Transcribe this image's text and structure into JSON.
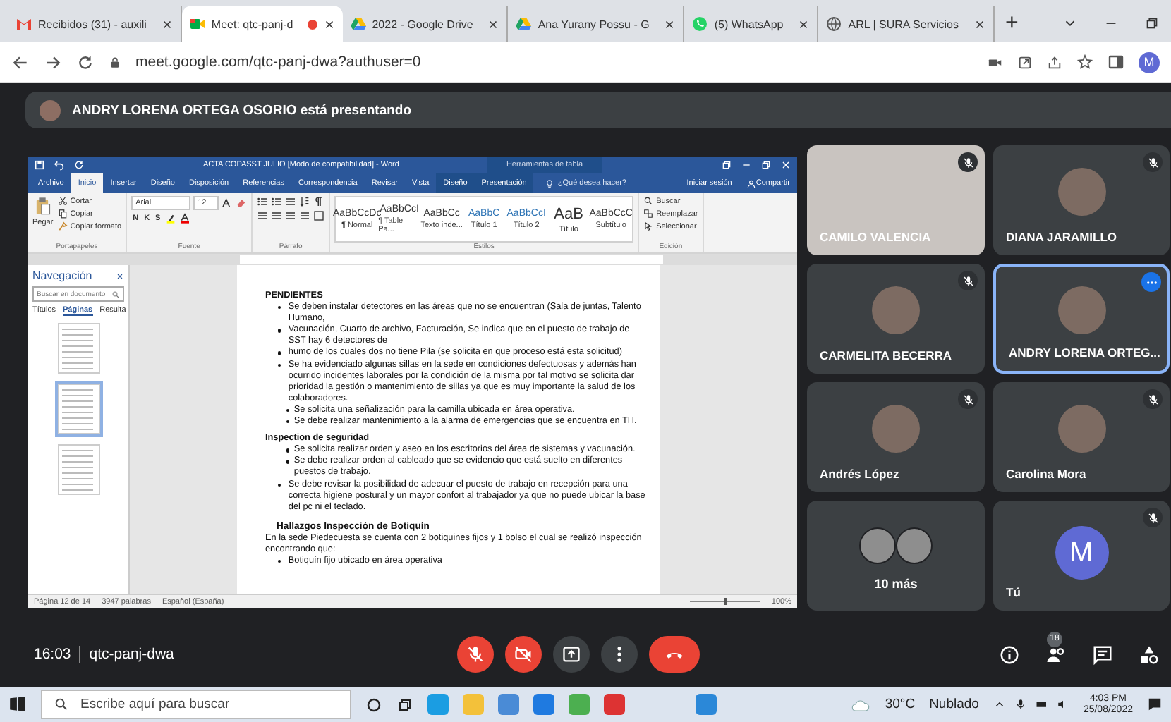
{
  "browser": {
    "tabs": [
      {
        "kind": "mail",
        "title": "Recibidos (31) - auxili",
        "selected": false,
        "recording": false
      },
      {
        "kind": "meet",
        "title": "Meet: qtc-panj-d",
        "selected": true,
        "recording": true
      },
      {
        "kind": "drive",
        "title": "2022 - Google Drive",
        "selected": false,
        "recording": false
      },
      {
        "kind": "drive",
        "title": "Ana Yurany Possu - G",
        "selected": false,
        "recording": false
      },
      {
        "kind": "whatsapp",
        "title": "(5) WhatsApp",
        "selected": false,
        "recording": false
      },
      {
        "kind": "globe",
        "title": "ARL | SURA Servicios",
        "selected": false,
        "recording": false
      }
    ],
    "new_tab": "+",
    "url": "meet.google.com/qtc-panj-dwa?authuser=0",
    "profile": "M"
  },
  "banner": {
    "text": "ANDRY LORENA ORTEGA OSORIO está presentando"
  },
  "word": {
    "title": "ACTA COPASST JULIO [Modo de compatibilidad] - Word",
    "context_label": "Herramientas de tabla",
    "tabs": [
      {
        "label": "Archivo",
        "selected": false,
        "contextual": false
      },
      {
        "label": "Inicio",
        "selected": true,
        "contextual": false
      },
      {
        "label": "Insertar",
        "selected": false,
        "contextual": false
      },
      {
        "label": "Diseño",
        "selected": false,
        "contextual": false
      },
      {
        "label": "Disposición",
        "selected": false,
        "contextual": false
      },
      {
        "label": "Referencias",
        "selected": false,
        "contextual": false
      },
      {
        "label": "Correspondencia",
        "selected": false,
        "contextual": false
      },
      {
        "label": "Revisar",
        "selected": false,
        "contextual": false
      },
      {
        "label": "Vista",
        "selected": false,
        "contextual": false
      },
      {
        "label": "Diseño",
        "selected": false,
        "contextual": true
      },
      {
        "label": "Presentación",
        "selected": false,
        "contextual": true
      }
    ],
    "tell_me": "¿Qué desea hacer?",
    "sign_in": "Iniciar sesión",
    "share": "Compartir",
    "paste": "Pegar",
    "clipboard": [
      "Cortar",
      "Copiar",
      "Copiar formato"
    ],
    "font": "Arial",
    "size": "12",
    "format_buttons": [
      "N",
      "K",
      "S"
    ],
    "styles": [
      {
        "preview": "AaBbCcDc",
        "name": "¶ Normal"
      },
      {
        "preview": "AaBbCcI",
        "name": "¶ Table Pa..."
      },
      {
        "preview": "AaBbCc",
        "name": "Texto inde..."
      },
      {
        "preview": "AaBbC",
        "name": "Título 1"
      },
      {
        "preview": "AaBbCcI",
        "name": "Título 2"
      },
      {
        "preview": "AaB",
        "name": "Título"
      },
      {
        "preview": "AaBbCcC",
        "name": "Subtítulo"
      }
    ],
    "editing": [
      "Buscar",
      "Reemplazar",
      "Seleccionar"
    ],
    "groups": [
      "Portapapeles",
      "Fuente",
      "Párrafo",
      "Estilos",
      "Edición"
    ],
    "nav": {
      "title": "Navegación",
      "placeholder": "Buscar en documento",
      "tabs": [
        {
          "label": "Títulos",
          "selected": false
        },
        {
          "label": "Páginas",
          "selected": true
        },
        {
          "label": "Resulta",
          "selected": false
        }
      ]
    },
    "document": [
      {
        "kind": "heading",
        "text": "PENDIENTES"
      },
      {
        "kind": "bullet",
        "text": "Se deben instalar detectores en las áreas que no se encuentran (Sala de juntas, Talento Humano,"
      },
      {
        "kind": "bullet",
        "text": "Vacunación, Cuarto de archivo, Facturación, Se indica que en el puesto de trabajo de SST hay 6 detectores de"
      },
      {
        "kind": "bullet",
        "text": "humo de los cuales dos no tiene Pila (se solicita en que proceso está esta solicitud)"
      },
      {
        "kind": "bullet",
        "text": "Se ha evidenciado algunas sillas en la sede en condiciones defectuosas y además han ocurrido incidentes laborales por la condición de la misma por tal motivo se solicita dar prioridad la gestión o mantenimiento de sillas ya que es muy importante la salud de los colaboradores."
      },
      {
        "kind": "subbullet",
        "text": "Se solicita una señalización para la camilla ubicada en área operativa."
      },
      {
        "kind": "subbullet",
        "text": "Se debe realizar mantenimiento a la alarma de emergencias que se encuentra en TH."
      },
      {
        "kind": "heading",
        "text": "Inspection de seguridad"
      },
      {
        "kind": "subbullet",
        "text": "Se solicita realizar orden y aseo en los escritorios del área de sistemas y vacunación."
      },
      {
        "kind": "subbullet",
        "text": "Se debe realizar orden al cableado que se evidencio que está suelto en diferentes puestos de trabajo."
      },
      {
        "kind": "bullet",
        "text": "Se debe revisar la posibilidad de adecuar el puesto de trabajo en recepción para una correcta higiene postural y un mayor confort al trabajador ya que no puede ubicar la base del pc ni el teclado."
      },
      {
        "kind": "subheading",
        "text": "Hallazgos Inspección de Botiquín"
      },
      {
        "kind": "para",
        "text": "En la sede Piedecuesta se cuenta con 2 botiquines fijos y 1 bolso el cual se realizó inspección encontrando que:"
      },
      {
        "kind": "bullet",
        "text": "Botiquín fijo ubicado en área operativa"
      }
    ],
    "status": [
      "Página 12 de 14",
      "3947 palabras",
      "Español (España)"
    ],
    "zoom_slider": {
      "level": 0.5
    },
    "zoom": "100%"
  },
  "participants": [
    {
      "kind": "video",
      "name": "CAMILO VALENCIA",
      "muted": true,
      "highlighted": false
    },
    {
      "kind": "avatar",
      "name": "DIANA JARAMILLO",
      "muted": true,
      "highlighted": false
    },
    {
      "kind": "avatar",
      "name": "CARMELITA BECERRA",
      "muted": true,
      "highlighted": false
    },
    {
      "kind": "avatar",
      "name": "ANDRY LORENA ORTEG...",
      "muted": false,
      "highlighted": true
    },
    {
      "kind": "avatar",
      "name": "Andrés López",
      "muted": true,
      "highlighted": false
    },
    {
      "kind": "avatar",
      "name": "Carolina Mora",
      "muted": true,
      "highlighted": false
    },
    {
      "kind": "more",
      "name": "10 más",
      "muted": false,
      "highlighted": false
    },
    {
      "kind": "letter",
      "name": "Tú",
      "letter": "M",
      "muted": true,
      "highlighted": false
    }
  ],
  "meeting": {
    "time": "16:03",
    "code": "qtc-panj-dwa",
    "people_count": "18"
  },
  "taskbar": {
    "search_placeholder": "Escribe aquí para buscar",
    "temperature": "30°C",
    "weather": "Nublado",
    "time": "4:03 PM",
    "date": "25/08/2022"
  }
}
